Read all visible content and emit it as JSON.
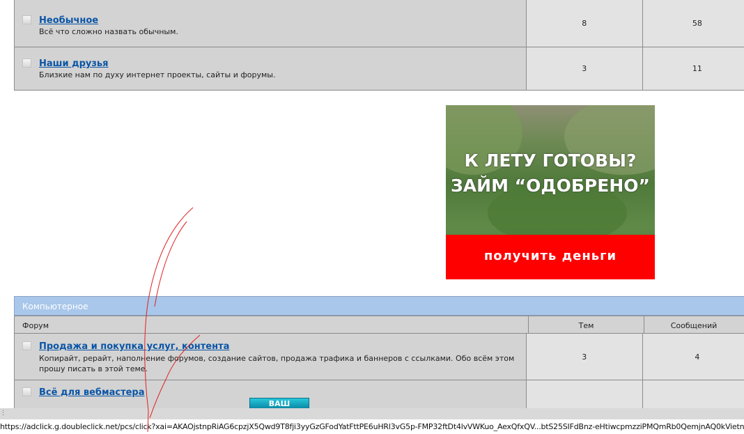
{
  "forums_top": [
    {
      "title": "Необычное",
      "description": "Всё что сложно назвать обычным.",
      "topics": "8",
      "posts": "58"
    },
    {
      "title": "Наши друзья",
      "description": "Близкие нам по духу интернет проекты, сайты и форумы.",
      "topics": "3",
      "posts": "11"
    }
  ],
  "ad": {
    "headline_line1": "К ЛЕТУ ГОТОВЫ?",
    "headline_line2": "ЗАЙМ “ОДОБРЕНО”",
    "cta": "получить деньги"
  },
  "category": {
    "title": "Компьютерное",
    "col_forum": "Форум",
    "col_topics": "Тем",
    "col_posts": "Сообщений"
  },
  "forums_computer": [
    {
      "title": "Продажа и покупка услуг, контента",
      "description": "Копирайт, рерайт, наполнение форумов, создание сайтов, продажа трафика и баннеров с ссылками. Обо всём этом прошу писать в этой теме.",
      "topics": "3",
      "posts": "4"
    },
    {
      "title": "Всё для вебмастера"
    }
  ],
  "floating_button": "ВАШ",
  "status_bar_url": "https://adclick.g.doubleclick.net/pcs/click?xai=AKAOjstnpRiAG6cpzjX5Qwd9T8fji3yyGzGFodYatFttPE6uHRl3vG5p-FMP32ftDt4lvVWKuo_AexQfxQV...btS25SIFdBnz-eHtiwcpmzziPMQmRb0QemjnAQ0kVietn"
}
